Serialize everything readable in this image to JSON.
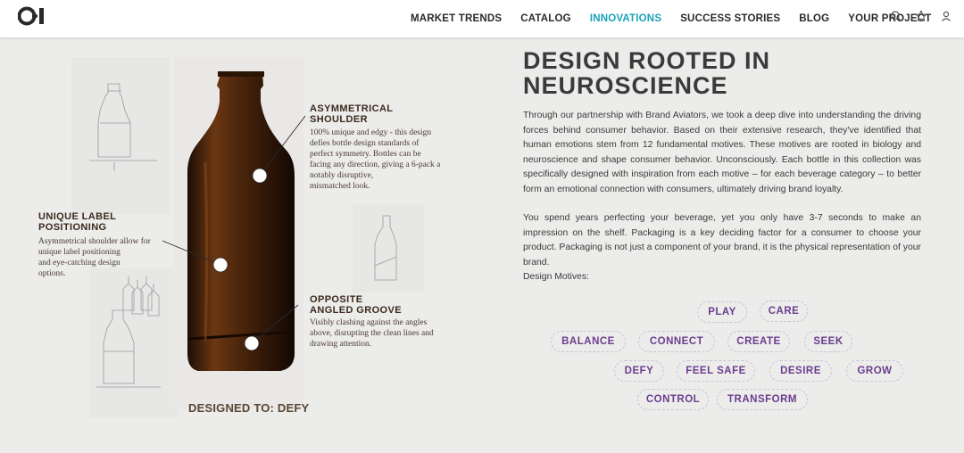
{
  "header": {
    "nav": [
      "MARKET TRENDS",
      "CATALOG",
      "INNOVATIONS",
      "SUCCESS STORIES",
      "BLOG",
      "YOUR PROJECT"
    ],
    "active_nav": "INNOVATIONS",
    "icons": [
      "search-icon",
      "star-icon",
      "user-icon"
    ],
    "accent": "#1aa3b8"
  },
  "illustration": {
    "callouts": {
      "shoulder": {
        "title": "ASYMMETRICAL\nSHOULDER",
        "text": "100% unique and edgy - this design\ndefies bottle design standards of\nperfect symmetry. Bottles can be\nfacing any direction, giving a 6-pack a\nnotably disruptive,\nmismatched look."
      },
      "label": {
        "title": "UNIQUE LABEL\nPOSITIONING",
        "text": "Asymmetrical shoulder allow for\nunique label positioning\nand eye-catching design\noptions."
      },
      "groove": {
        "title": "OPPOSITE\nANGLED GROOVE",
        "text": "Visibly clashing against the angles\nabove, disrupting the clean lines and\ndrawing attention."
      }
    },
    "designed_to": "DESIGNED TO: DEFY"
  },
  "content": {
    "headline": "DESIGN ROOTED IN NEUROSCIENCE",
    "paragraph1": "Through our partnership with Brand Aviators, we took a deep dive into understanding the driving forces behind consumer behavior. Based on their extensive research, they've identified that human emotions stem from 12 fundamental motives. These motives are rooted in biology and neuroscience and shape consumer behavior. Unconsciously. Each bottle in this collection was specifically designed with inspiration from each motive – for each beverage category – to better form an emotional connection with consumers, ultimately driving brand loyalty.",
    "paragraph2": "You spend years perfecting your beverage, yet you only have 3-7 seconds to make an impression on the shelf. Packaging is a key deciding factor for a consumer to choose your product. Packaging is not just a component of your brand, it is the physical representation of your brand.",
    "motives_label": "Design Motives:",
    "motives": [
      "PLAY",
      "CARE",
      "BALANCE",
      "CONNECT",
      "CREATE",
      "SEEK",
      "DEFY",
      "FEEL SAFE",
      "DESIRE",
      "GROW",
      "CONTROL",
      "TRANSFORM"
    ],
    "motive_color": "#6b3d8f"
  }
}
